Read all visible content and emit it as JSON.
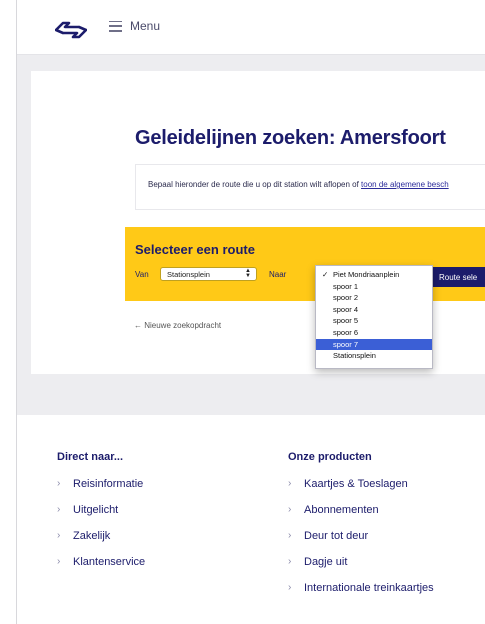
{
  "header": {
    "menu_label": "Menu"
  },
  "page": {
    "title": "Geleidelijnen zoeken: Amersfoort",
    "intro_prefix": "Bepaal hieronder de route die u op dit station wilt aflopen of ",
    "intro_link": "toon de algemene besch"
  },
  "route": {
    "title": "Selecteer een route",
    "van_label": "Van",
    "van_value": "Stationsplein",
    "naar_label": "Naar",
    "button_label": "Route sele",
    "options": [
      {
        "label": "Piet Mondriaanplein",
        "selected": true,
        "highlighted": false
      },
      {
        "label": "spoor 1",
        "selected": false,
        "highlighted": false
      },
      {
        "label": "spoor 2",
        "selected": false,
        "highlighted": false
      },
      {
        "label": "spoor 4",
        "selected": false,
        "highlighted": false
      },
      {
        "label": "spoor 5",
        "selected": false,
        "highlighted": false
      },
      {
        "label": "spoor 6",
        "selected": false,
        "highlighted": false
      },
      {
        "label": "spoor 7",
        "selected": false,
        "highlighted": true
      },
      {
        "label": "Stationsplein",
        "selected": false,
        "highlighted": false
      }
    ],
    "new_search": "← Nieuwe zoekopdracht"
  },
  "footer": {
    "col1": {
      "heading": "Direct naar...",
      "links": [
        "Reisinformatie",
        "Uitgelicht",
        "Zakelijk",
        "Klantenservice"
      ]
    },
    "col2": {
      "heading": "Onze producten",
      "links": [
        "Kaartjes & Toeslagen",
        "Abonnementen",
        "Deur tot deur",
        "Dagje uit",
        "Internationale treinkaartjes"
      ]
    }
  },
  "colors": {
    "brand_blue": "#1c1c6b",
    "brand_yellow": "#ffc917",
    "highlight_blue": "#3b5fd6"
  },
  "icons": {
    "logo": "ns-logo-icon",
    "menu": "hamburger-icon",
    "footer_link": "chevron-right-icon",
    "select": "select-arrows-icon",
    "check": "checkmark-icon"
  }
}
